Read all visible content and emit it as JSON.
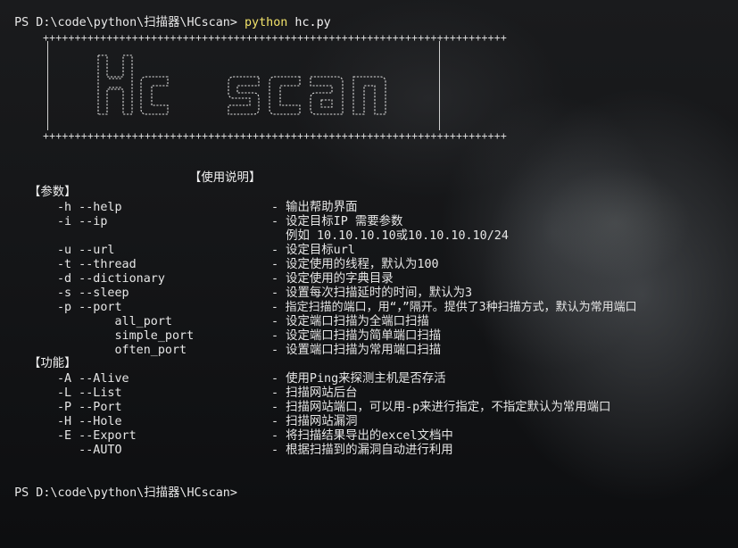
{
  "terminal": {
    "prompt1": "PS D:\\code\\python\\扫描器\\HCscan>",
    "cmd_name": "python",
    "cmd_arg": "hc.py",
    "prompt2": "PS D:\\code\\python\\扫描器\\HCscan>"
  },
  "banner": {
    "border": "+++++++++++++++++++++++++++++++++++++++++++++++++++++++++++++++++++++++++",
    "logo": "Hc scan"
  },
  "help": {
    "title": "【使用说明】",
    "params_heading": "【参数】",
    "params": [
      {
        "opt": "-h --help",
        "desc": "- 输出帮助界面"
      },
      {
        "opt": "-i --ip",
        "desc": "- 设定目标IP 需要参数"
      },
      {
        "opt": "",
        "desc": "  例如 10.10.10.10或10.10.10.10/24"
      },
      {
        "opt": "-u --url",
        "desc": "- 设定目标url"
      },
      {
        "opt": "-t --thread",
        "desc": "- 设定使用的线程，默认为100"
      },
      {
        "opt": "-d --dictionary",
        "desc": "- 设定使用的字典目录"
      },
      {
        "opt": "-s --sleep",
        "desc": "- 设置每次扫描延时的时间，默认为3"
      },
      {
        "opt": "-p --port",
        "desc": "- 指定扫描的端口，用“，”隔开。提供了3种扫描方式，默认为常用端口"
      },
      {
        "opt": "        all_port",
        "desc": "- 设定端口扫描为全端口扫描"
      },
      {
        "opt": "        simple_port",
        "desc": "- 设定端口扫描为简单端口扫描"
      },
      {
        "opt": "        often_port",
        "desc": "- 设置端口扫描为常用端口扫描"
      }
    ],
    "func_heading": "【功能】",
    "funcs": [
      {
        "opt": "-A --Alive",
        "desc": "- 使用Ping来探测主机是否存活"
      },
      {
        "opt": "-L --List",
        "desc": "- 扫描网站后台"
      },
      {
        "opt": "-P --Port",
        "desc": "- 扫描网站端口，可以用-p来进行指定，不指定默认为常用端口"
      },
      {
        "opt": "-H --Hole",
        "desc": "- 扫描网站漏洞"
      },
      {
        "opt": "-E --Export",
        "desc": "- 将扫描结果导出的excel文档中"
      },
      {
        "opt": "   --AUTO",
        "desc": "- 根据扫描到的漏洞自动进行利用"
      }
    ]
  }
}
